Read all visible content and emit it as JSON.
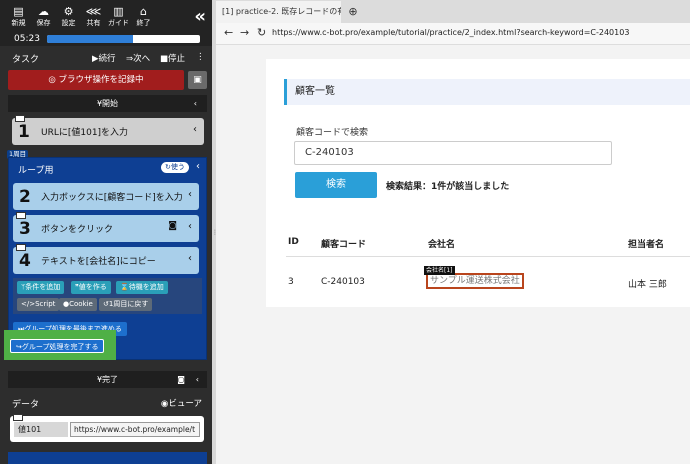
{
  "toolbar": {
    "items": [
      {
        "icon": "new-icon",
        "glyph": "▤",
        "label": "新規"
      },
      {
        "icon": "save-icon",
        "glyph": "☁",
        "label": "保存"
      },
      {
        "icon": "gear-icon",
        "glyph": "⚙",
        "label": "設定"
      },
      {
        "icon": "share-icon",
        "glyph": "⋘",
        "label": "共有"
      },
      {
        "icon": "guide-icon",
        "glyph": "▥",
        "label": "ガイド"
      },
      {
        "icon": "exit-icon",
        "glyph": "⌂",
        "label": "終了"
      }
    ],
    "collapse": "«",
    "timer": "05:23",
    "progress": 0.56
  },
  "task": {
    "label": "タスク",
    "continue": "続行",
    "next": "次へ",
    "stop": "停止",
    "more": "⋮"
  },
  "record_button": "ブラウザ操作を記録中",
  "start_label": "開始",
  "steps": {
    "s1": {
      "num": "1",
      "text": "URLに[値101]を入力"
    },
    "loop_badge": "1周目",
    "loop_title": "ループ用",
    "loop_use": "使う",
    "s2": {
      "num": "2",
      "text": "入力ボックスに[顧客コード]を入力"
    },
    "s3": {
      "num": "3",
      "text": "ボタンをクリック"
    },
    "s4": {
      "num": "4",
      "text": "テキストを[会社名]にコピー"
    }
  },
  "tools": {
    "add_condition": "条件を追加",
    "make_value": "値を作る",
    "wait": "待機を追加",
    "script": "Script",
    "cookie": "Cookie",
    "back_first": "1周目に戻す",
    "group_to_end": "グループ処理を最後まで進める",
    "group_complete": "グループ処理を完了する"
  },
  "end_label": "完了",
  "data": {
    "label": "データ",
    "viewer": "ビューア",
    "var_name": "値101",
    "var_value": "https://www.c-bot.pro/example/t"
  },
  "browser": {
    "tab_title": "[1] practice-2. 既存レコードの有",
    "url": "https://www.c-bot.pro/example/tutorial/practice/2_index.html?search-keyword=C-240103"
  },
  "page": {
    "section_title": "顧客一覧",
    "search_label": "顧客コードで検索",
    "search_value": "C-240103",
    "search_button": "検索",
    "result": "検索結果：1件が該当しました",
    "headers": [
      "ID",
      "顧客コード",
      "会社名",
      "担当者名"
    ],
    "row": {
      "id": "3",
      "code": "C-240103",
      "company": "サンプル運送株式会社",
      "person": "山本 三郎"
    },
    "tooltip": "会社名[1]"
  }
}
